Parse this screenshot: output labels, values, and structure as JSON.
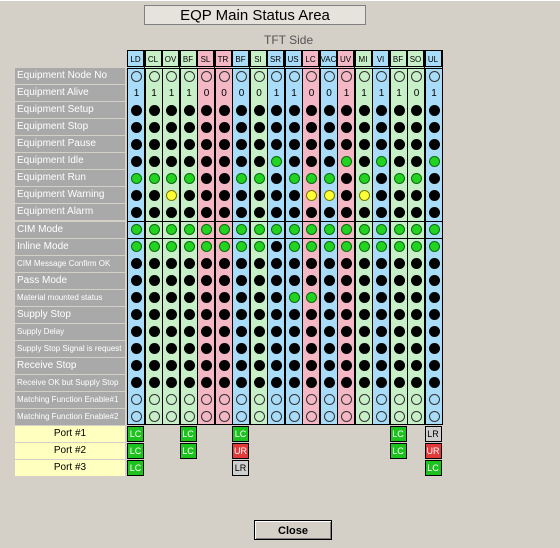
{
  "title": "EQP  Main Status Area",
  "side_label": "TFT Side",
  "columns": [
    "LD",
    "CL",
    "OV",
    "BF",
    "SL",
    "TR",
    "BF",
    "SI",
    "SR",
    "US",
    "LC",
    "VAC",
    "UV",
    "MI",
    "VI",
    "BF",
    "SO",
    "UL"
  ],
  "column_colors": [
    "#a8dcf8",
    "#c8f0c8",
    "#c8f0c8",
    "#c8f0c8",
    "#f4b7c4",
    "#f4b7c4",
    "#a8dcf8",
    "#c8f0c8",
    "#a8dcf8",
    "#a8dcf8",
    "#f4b7c4",
    "#a8dcf8",
    "#f4b7c4",
    "#c8f0c8",
    "#a8dcf8",
    "#c8f0c8",
    "#c8f0c8",
    "#a8dcf8"
  ],
  "rows": [
    {
      "label": "Equipment Node No",
      "type": "empty"
    },
    {
      "label": "Equipment Alive",
      "type": "number",
      "values": [
        "1",
        "1",
        "1",
        "1",
        "0",
        "0",
        "0",
        "0",
        "1",
        "1",
        "0",
        "0",
        "1",
        "1",
        "1",
        "1",
        "0",
        "1"
      ]
    },
    {
      "label": "Equipment Setup",
      "type": "dots",
      "values": [
        "B",
        "B",
        "B",
        "B",
        "B",
        "B",
        "B",
        "B",
        "B",
        "B",
        "B",
        "B",
        "B",
        "B",
        "B",
        "B",
        "B",
        "B"
      ]
    },
    {
      "label": "Equipment Stop",
      "type": "dots",
      "values": [
        "B",
        "B",
        "B",
        "B",
        "B",
        "B",
        "B",
        "B",
        "B",
        "B",
        "B",
        "B",
        "B",
        "B",
        "B",
        "B",
        "B",
        "B"
      ]
    },
    {
      "label": "Equipment Pause",
      "type": "dots",
      "values": [
        "B",
        "B",
        "B",
        "B",
        "B",
        "B",
        "B",
        "B",
        "B",
        "B",
        "B",
        "B",
        "B",
        "B",
        "B",
        "B",
        "B",
        "B"
      ]
    },
    {
      "label": "Equipment Idle",
      "type": "dots",
      "values": [
        "B",
        "B",
        "B",
        "B",
        "B",
        "B",
        "B",
        "B",
        "G",
        "B",
        "B",
        "B",
        "G",
        "B",
        "G",
        "B",
        "B",
        "G"
      ]
    },
    {
      "label": "Equipment Run",
      "type": "dots",
      "values": [
        "G",
        "G",
        "G",
        "G",
        "B",
        "B",
        "G",
        "G",
        "B",
        "G",
        "G",
        "G",
        "B",
        "G",
        "B",
        "G",
        "G",
        "B"
      ]
    },
    {
      "label": "Equipment Warning",
      "type": "dots",
      "values": [
        "B",
        "B",
        "Y",
        "B",
        "B",
        "B",
        "B",
        "B",
        "B",
        "B",
        "Y",
        "Y",
        "B",
        "Y",
        "B",
        "B",
        "B",
        "B"
      ]
    },
    {
      "label": "Equipment Alarm",
      "type": "dots",
      "values": [
        "B",
        "B",
        "B",
        "B",
        "B",
        "B",
        "B",
        "B",
        "B",
        "B",
        "B",
        "B",
        "B",
        "B",
        "B",
        "B",
        "B",
        "B"
      ]
    },
    {
      "label": "CIM Mode",
      "type": "dots",
      "values": [
        "G",
        "G",
        "G",
        "G",
        "G",
        "G",
        "G",
        "G",
        "G",
        "G",
        "G",
        "G",
        "G",
        "G",
        "G",
        "G",
        "G",
        "G"
      ]
    },
    {
      "label": "Inline Mode",
      "type": "dots",
      "values": [
        "G",
        "G",
        "G",
        "G",
        "G",
        "G",
        "G",
        "G",
        "B",
        "G",
        "G",
        "G",
        "G",
        "G",
        "G",
        "G",
        "G",
        "G"
      ]
    },
    {
      "label": "CIM Message Confirm OK",
      "type": "dots",
      "small": true,
      "values": [
        "B",
        "B",
        "B",
        "B",
        "B",
        "B",
        "B",
        "B",
        "B",
        "B",
        "B",
        "B",
        "B",
        "B",
        "B",
        "B",
        "B",
        "B"
      ]
    },
    {
      "label": "Pass Mode",
      "type": "dots",
      "values": [
        "B",
        "B",
        "B",
        "B",
        "B",
        "B",
        "B",
        "B",
        "B",
        "B",
        "B",
        "B",
        "B",
        "B",
        "B",
        "B",
        "B",
        "B"
      ]
    },
    {
      "label": "Material mounted status",
      "type": "dots",
      "small": true,
      "values": [
        "B",
        "B",
        "B",
        "B",
        "B",
        "B",
        "B",
        "B",
        "B",
        "G",
        "G",
        "B",
        "B",
        "B",
        "B",
        "B",
        "B",
        "B"
      ]
    },
    {
      "label": "Supply Stop",
      "type": "dots",
      "values": [
        "B",
        "B",
        "B",
        "B",
        "B",
        "B",
        "B",
        "B",
        "B",
        "B",
        "B",
        "B",
        "B",
        "B",
        "B",
        "B",
        "B",
        "B"
      ]
    },
    {
      "label": "Supply Delay",
      "type": "dots",
      "small": true,
      "values": [
        "B",
        "B",
        "B",
        "B",
        "B",
        "B",
        "B",
        "B",
        "B",
        "B",
        "B",
        "B",
        "B",
        "B",
        "B",
        "B",
        "B",
        "B"
      ]
    },
    {
      "label": "Supply Stop Signal is request",
      "type": "dots",
      "small": true,
      "values": [
        "B",
        "B",
        "B",
        "B",
        "B",
        "B",
        "B",
        "B",
        "B",
        "B",
        "B",
        "B",
        "B",
        "B",
        "B",
        "B",
        "B",
        "B"
      ]
    },
    {
      "label": "Receive Stop",
      "type": "dots",
      "values": [
        "B",
        "B",
        "B",
        "B",
        "B",
        "B",
        "B",
        "B",
        "B",
        "B",
        "B",
        "B",
        "B",
        "B",
        "B",
        "B",
        "B",
        "B"
      ]
    },
    {
      "label": "Receive OK but Supply Stop",
      "type": "dots",
      "small": true,
      "values": [
        "B",
        "B",
        "B",
        "B",
        "B",
        "B",
        "B",
        "B",
        "B",
        "B",
        "B",
        "B",
        "B",
        "B",
        "B",
        "B",
        "B",
        "B"
      ]
    },
    {
      "label": "Matching Function Enable#1",
      "type": "empty",
      "small": true
    },
    {
      "label": "Matching Function Enable#2",
      "type": "empty",
      "small": true
    }
  ],
  "ports": [
    {
      "label": "Port #1",
      "cells": {
        "0": "LC",
        "3": "LC",
        "6": "LC",
        "15": "LC",
        "17": "LR"
      }
    },
    {
      "label": "Port #2",
      "cells": {
        "0": "LC",
        "3": "LC",
        "6": "UR",
        "15": "LC",
        "17": "UR"
      }
    },
    {
      "label": "Port #3",
      "cells": {
        "0": "LC",
        "6": "LR",
        "17": "LC"
      }
    }
  ],
  "close_label": "Close"
}
